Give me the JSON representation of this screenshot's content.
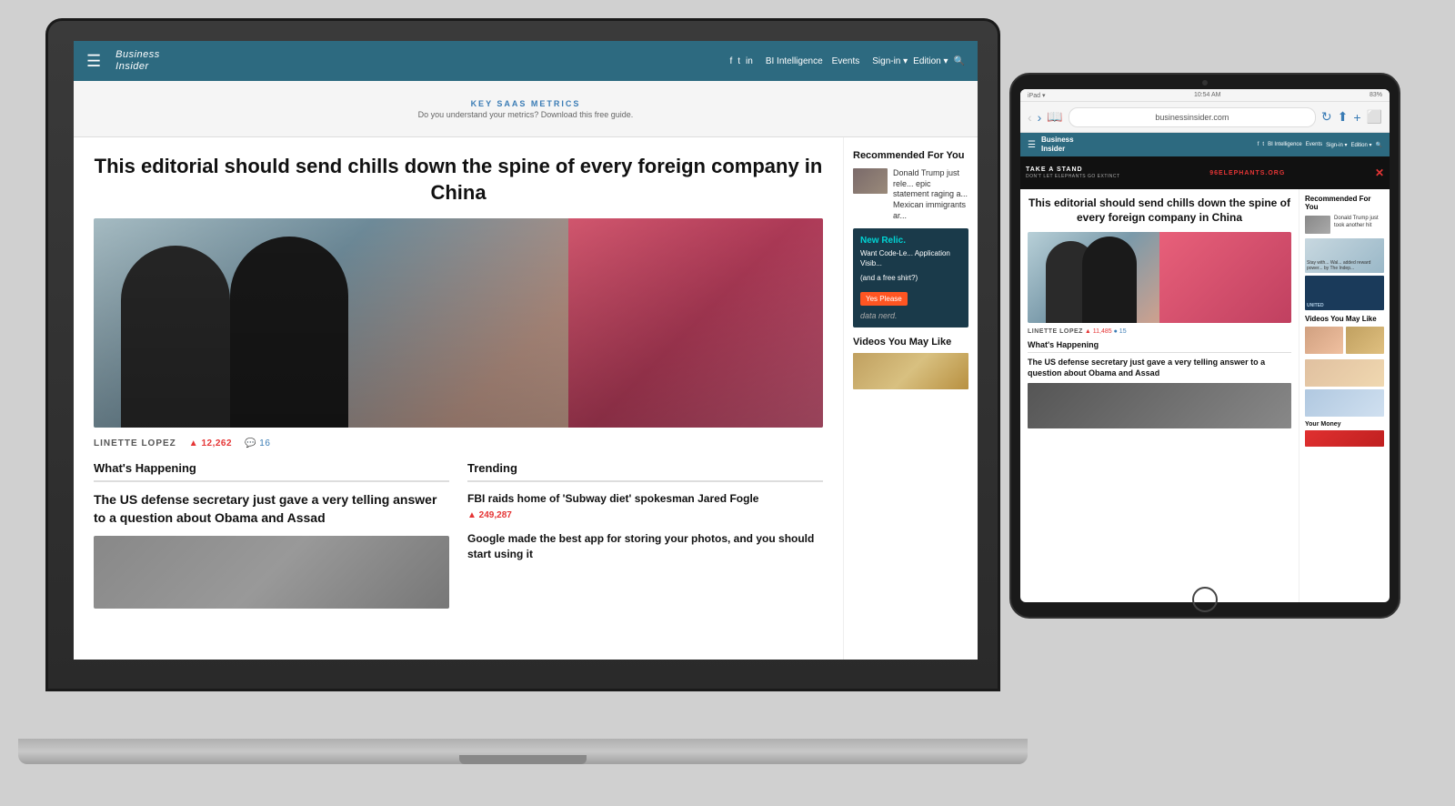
{
  "scene": {
    "background": "#d0d0d0"
  },
  "laptop": {
    "nav": {
      "hamburger": "☰",
      "logo_line1": "Business",
      "logo_line2": "Insider",
      "social": [
        "f",
        "t",
        "in"
      ],
      "links": [
        "BI Intelligence",
        "Events"
      ],
      "actions": [
        "Sign-in ▾",
        "Edition ▾",
        "🔍"
      ]
    },
    "ad": {
      "title": "KEY SAAS METRICS",
      "subtitle": "Do you understand your metrics? Download this free guide."
    },
    "article": {
      "headline": "This editorial should send chills down the spine of every foreign company in China",
      "author": "LINETTE LOPEZ",
      "upvotes": "▲ 12,262",
      "comments": "💬 16",
      "image_alt": "People wearing masks in front of a pink billboard"
    },
    "whats_happening": {
      "title": "What's Happening",
      "story": "The US defense secretary just gave a very telling answer to a question about Obama and Assad"
    },
    "trending": {
      "title": "Trending",
      "items": [
        {
          "title": "FBI raids home of 'Subway diet' spokesman Jared Fogle",
          "count": "▲ 249,287"
        },
        {
          "title": "Google made the best app for storing your photos, and you should start using it",
          "count": ""
        }
      ]
    },
    "sidebar": {
      "recommended_title": "Recommended For You",
      "recommended_item": "Donald Trump just rele... epic statement raging a... Mexican immigrants ar...",
      "ad": {
        "brand": "New Relic.",
        "title": "Want Code-Le... Application Visib...",
        "subtitle": "(and a free shirt?)",
        "button": "Yes Please"
      },
      "ad_sub": "data nerd.",
      "videos_title": "Videos You May Like"
    }
  },
  "tablet": {
    "status": {
      "time": "10:54 AM",
      "battery": "83%",
      "device": "iPad ▾"
    },
    "url": "businessinsider.com",
    "nav": {
      "hamburger": "☰",
      "logo_line1": "Business",
      "logo_line2": "Insider",
      "links": [
        "f",
        "t",
        "BI Intelligence",
        "Events"
      ],
      "actions": [
        "Sign-in ▾",
        "Edition ▾",
        "🔍"
      ]
    },
    "ad_banner": {
      "left": "TAKE A STAND",
      "sub": "DON'T LET ELEPHANTS GO EXTINCT",
      "right": "96ELEPHANTS.ORG",
      "close": "✕"
    },
    "article": {
      "headline": "This editorial should send chills down the spine of every foreign company in China",
      "author": "LINETTE LOPEZ",
      "upvotes": "▲ 11,485",
      "comments": "● 15"
    },
    "whats_happening": {
      "title": "What's Happening",
      "story": "The US defense secretary just gave a very telling answer to a question about Obama and Assad"
    },
    "sidebar": {
      "recommended_title": "Recommended For You",
      "item1": "Donald Trump just took another hit",
      "stack_items": [
        "Stay with... Wal... added reward power... by The Indep...",
        "UNITED"
      ],
      "videos_title": "Videos You May Like",
      "your_money": "Your Money"
    }
  }
}
